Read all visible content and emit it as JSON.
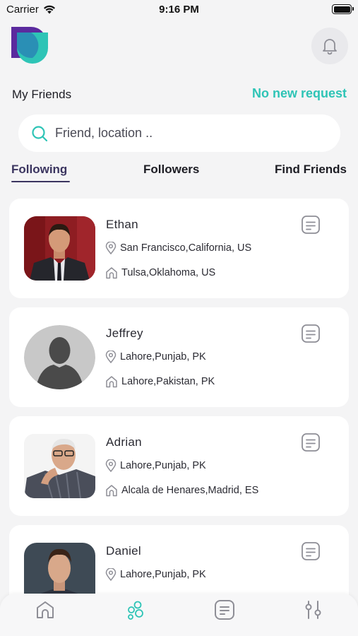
{
  "status": {
    "carrier": "Carrier",
    "time": "9:16 PM"
  },
  "header": {
    "title": "My Friends",
    "request_link": "No new request"
  },
  "search": {
    "placeholder": "Friend, location .."
  },
  "tabs": [
    {
      "label": "Following",
      "active": true
    },
    {
      "label": "Followers",
      "active": false
    },
    {
      "label": "Find Friends",
      "active": false
    }
  ],
  "friends": [
    {
      "name": "Ethan",
      "location": "San Francisco,California,  US",
      "home": "Tulsa,Oklahoma,  US"
    },
    {
      "name": "Jeffrey",
      "location": "Lahore,Punjab,  PK",
      "home": "Lahore,Pakistan,  PK"
    },
    {
      "name": "Adrian",
      "location": "Lahore,Punjab,  PK",
      "home": "Alcala de Henares,Madrid,  ES"
    },
    {
      "name": "Daniel",
      "location": "Lahore,Punjab,  PK",
      "home": ""
    }
  ],
  "nav": [
    {
      "icon": "home-icon",
      "active": false
    },
    {
      "icon": "friends-icon",
      "active": true
    },
    {
      "icon": "messages-icon",
      "active": false
    },
    {
      "icon": "settings-sliders-icon",
      "active": false
    }
  ],
  "colors": {
    "accent": "#2ec4b6",
    "tab_active": "#3b3560",
    "icon_gray": "#8e8e96",
    "logo_purple": "#5b2a9e"
  }
}
